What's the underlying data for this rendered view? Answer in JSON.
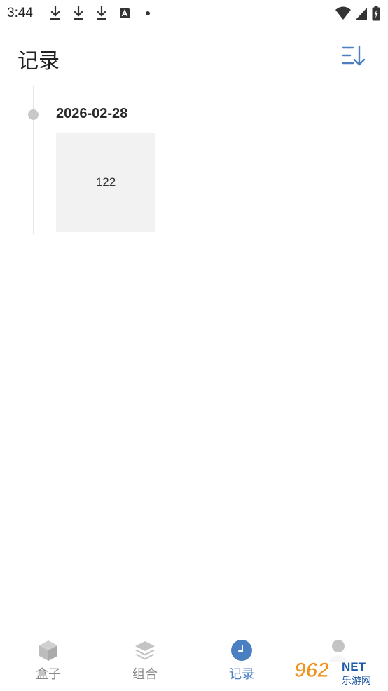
{
  "status_bar": {
    "time": "3:44",
    "left_icons": [
      "download-icon",
      "download-icon",
      "download-icon",
      "text-input-icon",
      "dot-icon"
    ],
    "right_icons": [
      "wifi-icon",
      "cellular-signal-icon",
      "battery-charging-icon"
    ]
  },
  "header": {
    "title": "记录",
    "sort_icon": "sort-descending-icon"
  },
  "timeline": {
    "entries": [
      {
        "date": "2026-02-28",
        "items": [
          {
            "label": "122"
          }
        ]
      }
    ]
  },
  "bottom_nav": {
    "items": [
      {
        "label": "盒子",
        "icon": "cube-icon",
        "active": false
      },
      {
        "label": "组合",
        "icon": "layers-icon",
        "active": false
      },
      {
        "label": "记录",
        "icon": "clock-icon",
        "active": true
      },
      {
        "label": "",
        "icon": "person-icon",
        "active": false
      }
    ]
  },
  "watermark": {
    "text": "962",
    "suffix": "NET",
    "subtext": "乐游网"
  },
  "colors": {
    "accent": "#4a7fc1",
    "inactive": "#c4c4c4",
    "card_bg": "#f2f2f2",
    "timeline_dot": "#c8c8c8",
    "watermark_orange": "#f2911c"
  }
}
